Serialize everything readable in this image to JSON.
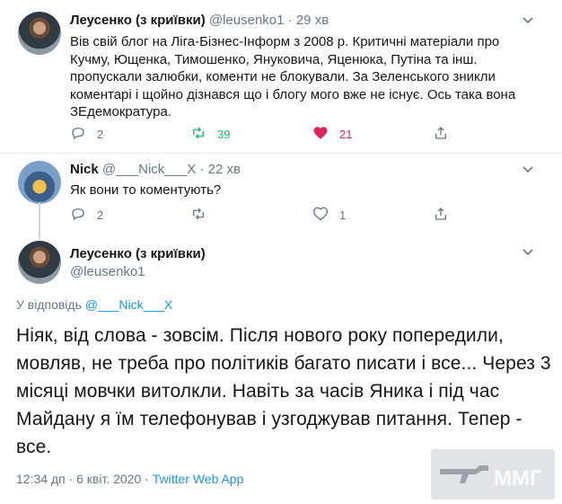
{
  "tweet1": {
    "name": "Леусенко (з криївки)",
    "handle": "@leusenko1",
    "time": "29 хв",
    "text": "Вів свій блог на Ліга-Бізнес-Інформ з 2008 р. Критичні матеріали про Кучму, Ющенка, Тимошенко, Януковича, Яценюка, Путіна та інш. пропускали залюбки, коменти не блокували. За Зеленського зникли коментарі і щойно дізнався що і блогу мого вже не існує. Ось така вона ЗЕдемократура.",
    "replies": "2",
    "retweets": "39",
    "likes": "21"
  },
  "tweet2": {
    "name": "Nick",
    "handle": "@___Nick___X",
    "time": "22 хв",
    "text": "Як вони то коментують?",
    "replies": "2",
    "retweets": "",
    "likes": "1"
  },
  "main_tweet": {
    "name": "Леусенко (з криївки)",
    "handle": "@leusenko1",
    "replying_prefix": "У відповідь",
    "replying_to": "@___Nick___X",
    "text": "Ніяк, від слова - зовсім. Після нового року попередили, мовляв, не треба про політиків багато писати і все... Через 3 місяці мовчки витолкли. Навіть за часів Яника і під час Майдану я їм телефонував і узгоджував питання. Тепер - все.",
    "timestamp": "12:34 дп · 6 квіт. 2020 · ",
    "source": "Twitter Web App"
  },
  "watermark": {
    "text": "ММГ"
  },
  "colors": {
    "accent": "#1b95e0",
    "retweet": "#17bf63",
    "like": "#e0245e",
    "muted": "#657786"
  },
  "icons": [
    "reply-icon",
    "retweet-icon",
    "like-icon",
    "share-icon",
    "chevron-down-icon"
  ]
}
